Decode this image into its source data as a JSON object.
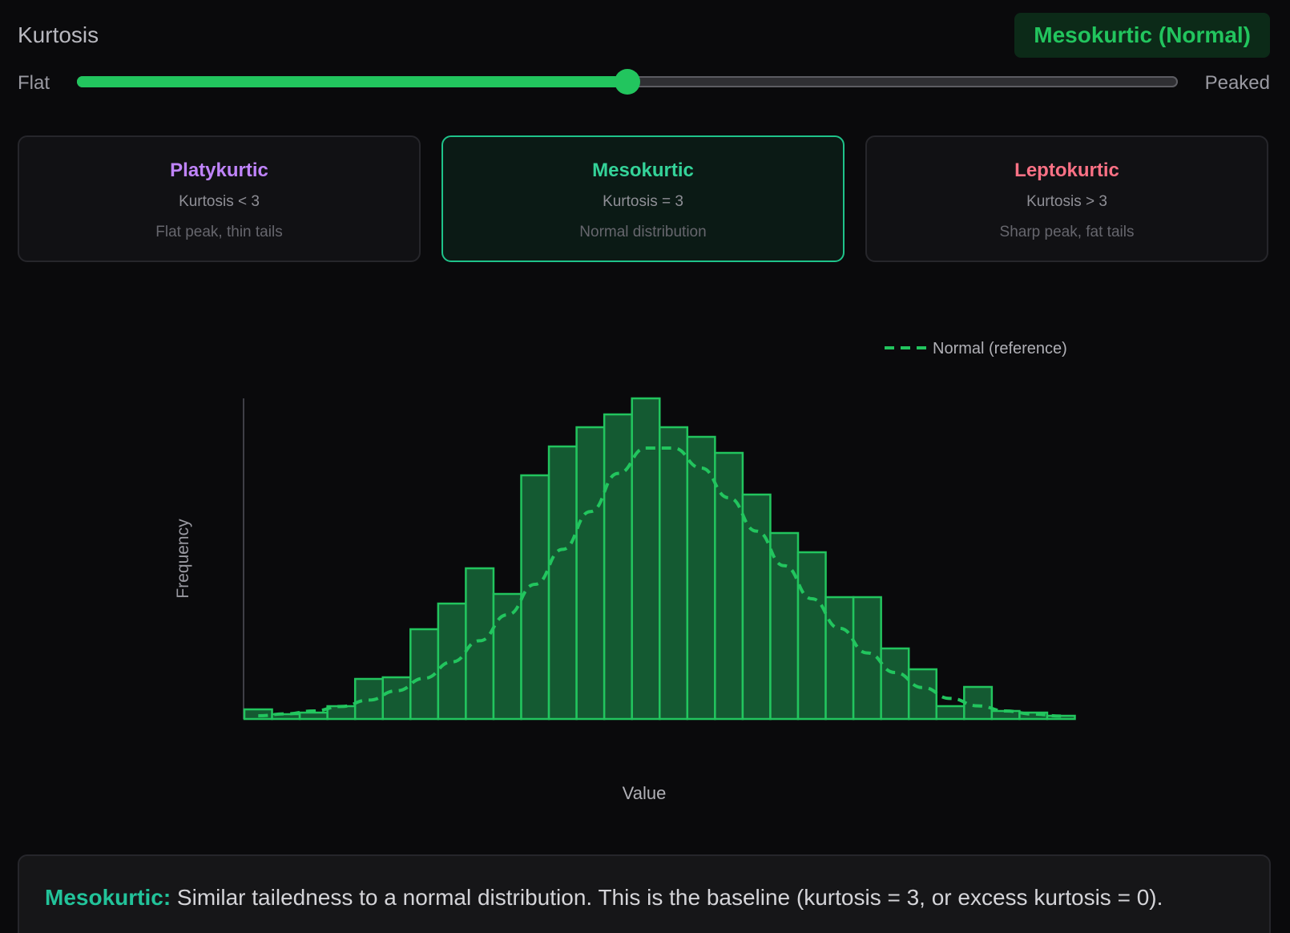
{
  "header": {
    "label": "Kurtosis",
    "badge": "Mesokurtic (Normal)"
  },
  "slider": {
    "left_label": "Flat",
    "right_label": "Peaked",
    "value_fraction": 0.5
  },
  "cards": [
    {
      "title": "Platykurtic",
      "subtitle": "Kurtosis < 3",
      "description": "Flat peak, thin tails",
      "color": "#c084fc",
      "active": false
    },
    {
      "title": "Mesokurtic",
      "subtitle": "Kurtosis = 3",
      "description": "Normal distribution",
      "color": "#34d399",
      "active": true
    },
    {
      "title": "Leptokurtic",
      "subtitle": "Kurtosis > 3",
      "description": "Sharp peak, fat tails",
      "color": "#fb7185",
      "active": false
    }
  ],
  "info": {
    "label": "Mesokurtic:",
    "text": " Similar tailedness to a normal distribution. This is the baseline (kurtosis = 3, or excess kurtosis = 0)."
  },
  "colors": {
    "accent": "#22c55e",
    "bar_fill": "#145a32",
    "bar_stroke": "#22c55e"
  },
  "chart_data": {
    "type": "bar",
    "xlabel": "Value",
    "ylabel": "Frequency",
    "legend": {
      "label": "Normal (reference)",
      "position": "top-right",
      "style": "dashed"
    },
    "grid": false,
    "ylim": [
      0,
      100
    ],
    "values": [
      3,
      1.5,
      2,
      4,
      12.5,
      13,
      28,
      36,
      47,
      39,
      76,
      85,
      91,
      95,
      100,
      91,
      88,
      83,
      70,
      58,
      52,
      38,
      38,
      22,
      15.5,
      4,
      10,
      2.5,
      2,
      1
    ],
    "reference_curve": [
      1,
      1.6,
      2.5,
      3.9,
      5.9,
      8.8,
      12.7,
      17.8,
      24.4,
      32.5,
      42,
      52.9,
      64.7,
      76.6,
      84.5,
      84.5,
      78.3,
      69,
      58.6,
      47.8,
      37.5,
      28.3,
      20.6,
      14.5,
      9.8,
      6.4,
      4.1,
      2.5,
      1.5,
      0.9
    ]
  }
}
